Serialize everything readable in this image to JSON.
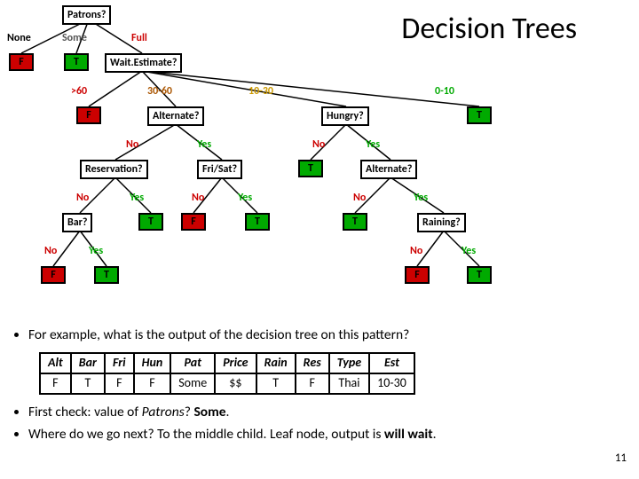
{
  "title": "Decision Trees",
  "tree": {
    "nodes": {
      "patrons": "Patrons?",
      "wait": "Wait.Estimate?",
      "alternate1": "Alternate?",
      "hungry": "Hungry?",
      "reservation": "Reservation?",
      "frisat": "Fri/Sat?",
      "alternate2": "Alternate?",
      "bar": "Bar?",
      "raining": "Raining?"
    },
    "edges": {
      "none": "None",
      "some": "Some",
      "full": "Full",
      "gt60": ">60",
      "e3060": "30-60",
      "e1030": "10-30",
      "e010": "0-10",
      "no": "No",
      "yes": "Yes"
    },
    "leaves": {
      "T": "T",
      "F": "F"
    }
  },
  "bullets": {
    "b1": "For example, what is the output of the decision tree on this pattern?",
    "b2_a": "First check: value of ",
    "b2_patrons": "Patrons",
    "b2_b": "? ",
    "b2_some": "Some",
    "b2_c": ".",
    "b3_a": "Where do we go next? To the middle child. Leaf node, output is ",
    "b3_will": "will wait",
    "b3_b": "."
  },
  "table": {
    "headers": [
      "Alt",
      "Bar",
      "Fri",
      "Hun",
      "Pat",
      "Price",
      "Rain",
      "Res",
      "Type",
      "Est"
    ],
    "row": [
      "F",
      "T",
      "F",
      "F",
      "Some",
      "$$",
      "T",
      "F",
      "Thai",
      "10-30"
    ]
  },
  "pagenum": "11"
}
